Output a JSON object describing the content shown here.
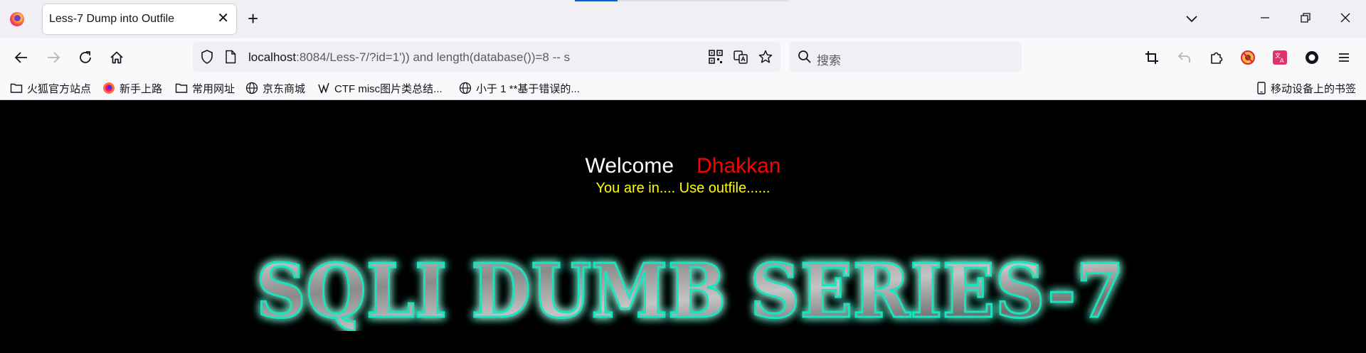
{
  "browser": {
    "tab_title": "Less-7 Dump into Outfile",
    "url_host": "localhost",
    "url_rest": ":8084/Less-7/?id=1')) and length(database())=8 -- s",
    "search_placeholder": "搜索"
  },
  "bookmarks": [
    {
      "label": "火狐官方站点",
      "icon": "folder-icon"
    },
    {
      "label": "新手上路",
      "icon": "firefox-icon"
    },
    {
      "label": "常用网址",
      "icon": "folder-icon"
    },
    {
      "label": "京东商城",
      "icon": "globe-icon"
    },
    {
      "label": "CTF misc图片类总结...",
      "icon": "ctf-icon"
    },
    {
      "label": "小于 1 **基于错误的...",
      "icon": "globe-icon"
    }
  ],
  "bookmarks_right": {
    "label": "移动设备上的书签",
    "icon": "mobile-icon"
  },
  "page": {
    "welcome": "Welcome",
    "name": "Dhakkan",
    "status": "You are in.... Use outfile......",
    "banner": "SQLI DUMB SERIES-7"
  },
  "colors": {
    "welcome": "#ffffff",
    "name": "#ff0000",
    "status": "#ffff00",
    "banner_glow": "#19e6c0"
  }
}
